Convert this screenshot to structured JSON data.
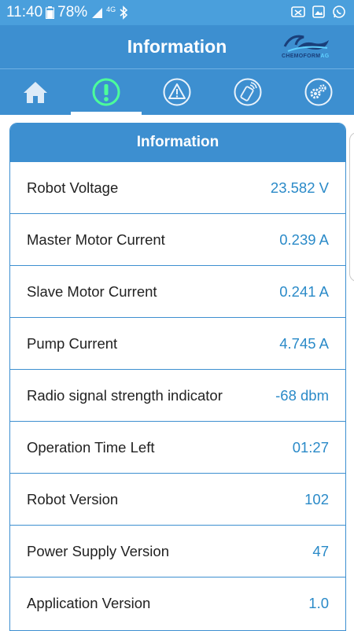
{
  "statusbar": {
    "time": "11:40",
    "battery": "78%",
    "network": "4G"
  },
  "header": {
    "title": "Information",
    "logo_text": "CHEMOFORM",
    "logo_suffix": "AG"
  },
  "tabs": [
    {
      "name": "home",
      "icon": "home-icon",
      "active": false
    },
    {
      "name": "information",
      "icon": "info-exclamation-icon",
      "active": true
    },
    {
      "name": "alerts",
      "icon": "warning-triangle-icon",
      "active": false
    },
    {
      "name": "remote",
      "icon": "remote-control-icon",
      "active": false
    },
    {
      "name": "settings",
      "icon": "gears-icon",
      "active": false
    }
  ],
  "card": {
    "title": "Information",
    "rows": [
      {
        "label": "Robot Voltage",
        "value": "23.582 V"
      },
      {
        "label": "Master Motor Current",
        "value": "0.239 A"
      },
      {
        "label": "Slave Motor Current",
        "value": "0.241 A"
      },
      {
        "label": "Pump Current",
        "value": "4.745 A"
      },
      {
        "label": "Radio signal strength indicator",
        "value": "-68 dbm"
      },
      {
        "label": "Operation Time Left",
        "value": "01:27"
      },
      {
        "label": "Robot Version",
        "value": "102"
      },
      {
        "label": "Power Supply Version",
        "value": "47"
      },
      {
        "label": "Application Version",
        "value": "1.0"
      }
    ]
  },
  "colors": {
    "statusbar": "#4a9fdc",
    "header": "#3d8fd0",
    "value_text": "#2a8ac8",
    "active_icon": "#4cff9a"
  }
}
